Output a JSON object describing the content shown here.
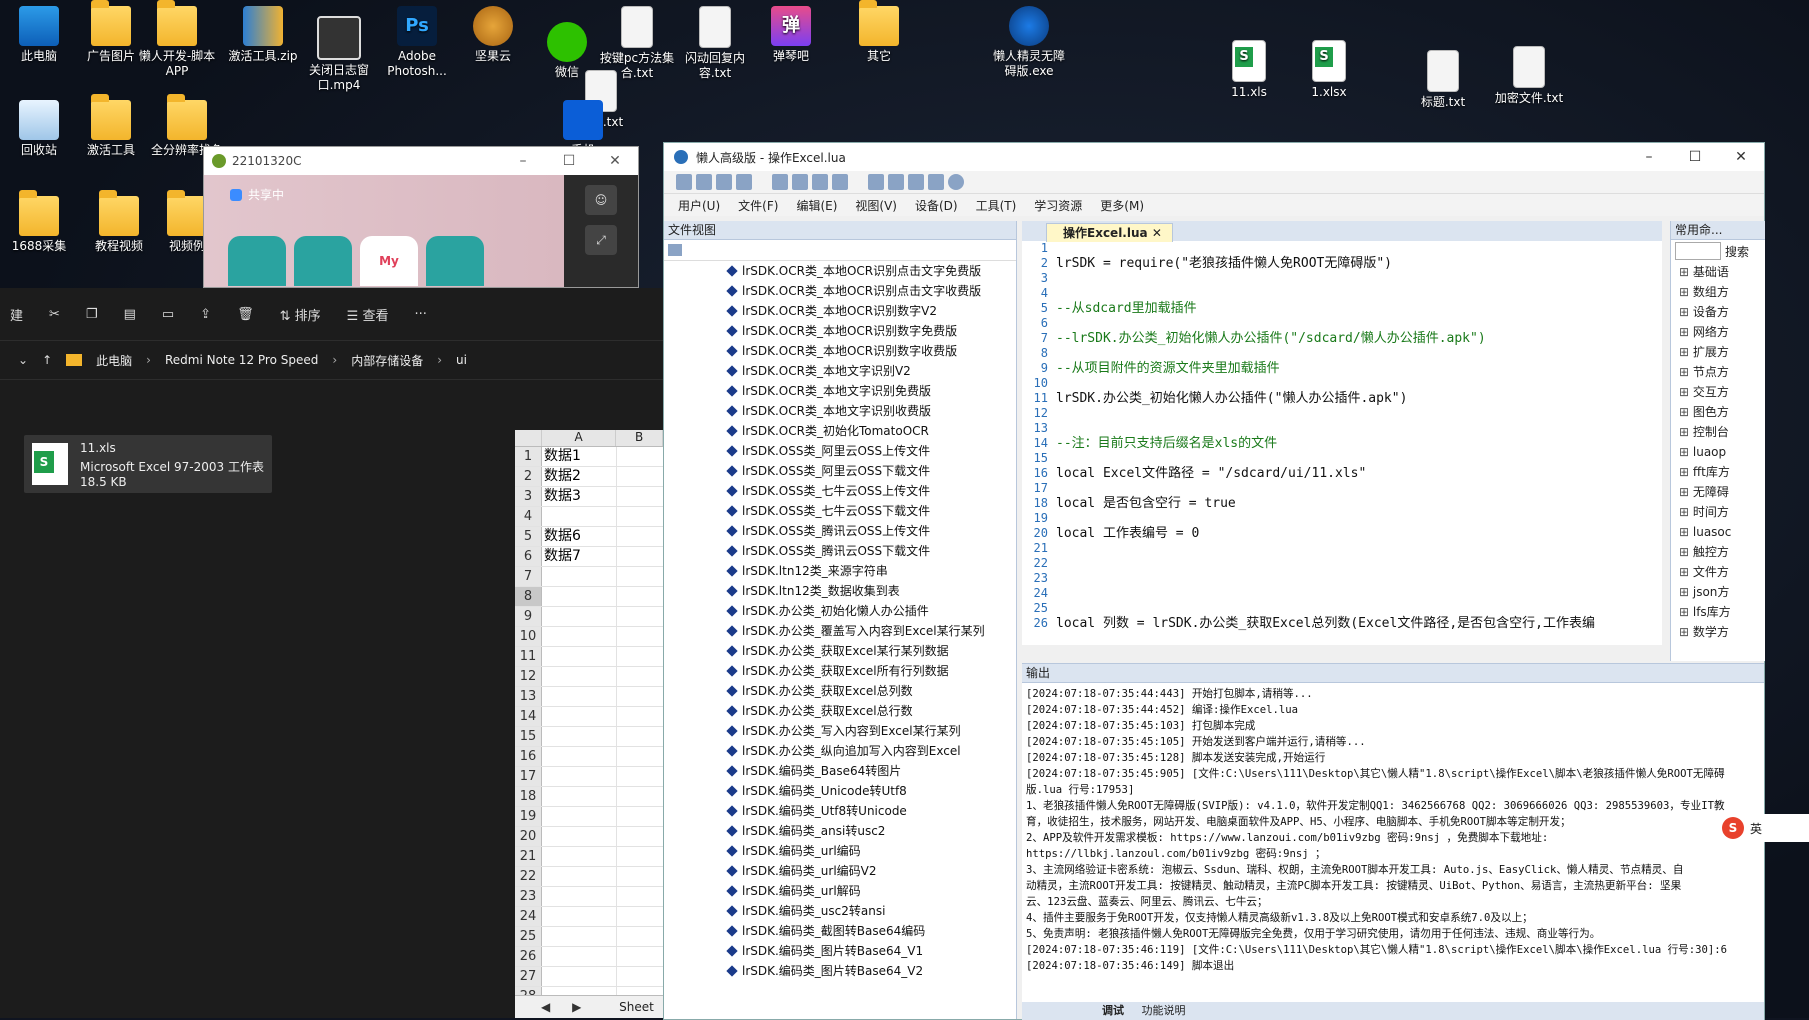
{
  "desktop": {
    "icons": [
      {
        "label": "此电脑",
        "type": "pc"
      },
      {
        "label": "广告图片",
        "type": "folder"
      },
      {
        "label": "懒人开发-脚本APP",
        "type": "folder"
      },
      {
        "label": "激活工具.zip",
        "type": "zip"
      },
      {
        "label": "关闭日志窗口.mp4",
        "type": "video"
      },
      {
        "label": "Adobe Photosh...",
        "type": "ps"
      },
      {
        "label": "坚果云",
        "type": "nut"
      },
      {
        "label": "微信",
        "type": "wechat"
      },
      {
        "label": "按键pc方法集合.txt",
        "type": "doc"
      },
      {
        "label": "闪动回复内容.txt",
        "type": "doc"
      },
      {
        "label": "弹琴吧",
        "type": "tan"
      },
      {
        "label": "其它",
        "type": "folder"
      },
      {
        "label": "懒人精灵无障碍版.exe",
        "type": "gear"
      },
      {
        "label": "11.xls",
        "type": "xls"
      },
      {
        "label": "1.xlsx",
        "type": "xls"
      },
      {
        "label": "标题.txt",
        "type": "doc"
      },
      {
        "label": "加密文件.txt",
        "type": "doc"
      },
      {
        "label": "回收站",
        "type": "recycle"
      },
      {
        "label": "激活工具",
        "type": "folder"
      },
      {
        "label": "全分辨率找色",
        "type": "folder"
      },
      {
        "label": "价格.txt",
        "type": "doc"
      },
      {
        "label": "手机",
        "type": "mobile"
      },
      {
        "label": "1688采集",
        "type": "folder"
      },
      {
        "label": "教程视频",
        "type": "folder"
      },
      {
        "label": "视频例",
        "type": "folder"
      }
    ]
  },
  "phone": {
    "title": "22101320C",
    "sharing": "共享中",
    "app_label": "My"
  },
  "explorer": {
    "toolbar": {
      "new": "建",
      "sort": "排序",
      "view": "查看",
      "more": "···"
    },
    "breadcrumb": [
      "此电脑",
      "Redmi Note 12 Pro Speed",
      "内部存储设备",
      "ui"
    ],
    "file": {
      "name": "11.xls",
      "type": "Microsoft Excel 97-2003 工作表",
      "size": "18.5 KB"
    }
  },
  "sheet": {
    "cols": [
      "A",
      "B"
    ],
    "rows": [
      {
        "n": "1",
        "a": "数据1"
      },
      {
        "n": "2",
        "a": "数据2"
      },
      {
        "n": "3",
        "a": "数据3"
      },
      {
        "n": "4",
        "a": ""
      },
      {
        "n": "5",
        "a": "数据6"
      },
      {
        "n": "6",
        "a": "数据7"
      },
      {
        "n": "7",
        "a": ""
      },
      {
        "n": "8",
        "a": ""
      },
      {
        "n": "9",
        "a": ""
      },
      {
        "n": "10",
        "a": ""
      },
      {
        "n": "11",
        "a": ""
      },
      {
        "n": "12",
        "a": ""
      },
      {
        "n": "13",
        "a": ""
      },
      {
        "n": "14",
        "a": ""
      },
      {
        "n": "15",
        "a": ""
      },
      {
        "n": "16",
        "a": ""
      },
      {
        "n": "17",
        "a": ""
      },
      {
        "n": "18",
        "a": ""
      },
      {
        "n": "19",
        "a": ""
      },
      {
        "n": "20",
        "a": ""
      },
      {
        "n": "21",
        "a": ""
      },
      {
        "n": "22",
        "a": ""
      },
      {
        "n": "23",
        "a": ""
      },
      {
        "n": "24",
        "a": ""
      },
      {
        "n": "25",
        "a": ""
      },
      {
        "n": "26",
        "a": ""
      },
      {
        "n": "27",
        "a": ""
      },
      {
        "n": "28",
        "a": ""
      }
    ],
    "selected_row": "8",
    "tab": "Sheet"
  },
  "ide": {
    "title": "懒人高级版 - 操作Excel.lua",
    "menu": [
      "用户(U)",
      "文件(F)",
      "编辑(E)",
      "视图(V)",
      "设备(D)",
      "工具(T)",
      "学习资源",
      "更多(M)"
    ],
    "fileview_title": "文件视图",
    "fileview_items": [
      "lrSDK.OCR类_本地OCR识别点击文字免费版",
      "lrSDK.OCR类_本地OCR识别点击文字收费版",
      "lrSDK.OCR类_本地OCR识别数字V2",
      "lrSDK.OCR类_本地OCR识别数字免费版",
      "lrSDK.OCR类_本地OCR识别数字收费版",
      "lrSDK.OCR类_本地文字识别V2",
      "lrSDK.OCR类_本地文字识别免费版",
      "lrSDK.OCR类_本地文字识别收费版",
      "lrSDK.OCR类_初始化TomatoOCR",
      "lrSDK.OSS类_阿里云OSS上传文件",
      "lrSDK.OSS类_阿里云OSS下载文件",
      "lrSDK.OSS类_七牛云OSS上传文件",
      "lrSDK.OSS类_七牛云OSS下载文件",
      "lrSDK.OSS类_腾讯云OSS上传文件",
      "lrSDK.OSS类_腾讯云OSS下载文件",
      "lrSDK.ltn12类_来源字符串",
      "lrSDK.ltn12类_数据收集到表",
      "lrSDK.办公类_初始化懒人办公插件",
      "lrSDK.办公类_覆盖写入内容到Excel某行某列",
      "lrSDK.办公类_获取Excel某行某列数据",
      "lrSDK.办公类_获取Excel所有行列数据",
      "lrSDK.办公类_获取Excel总列数",
      "lrSDK.办公类_获取Excel总行数",
      "lrSDK.办公类_写入内容到Excel某行某列",
      "lrSDK.办公类_纵向追加写入内容到Excel",
      "lrSDK.编码类_Base64转图片",
      "lrSDK.编码类_Unicode转Utf8",
      "lrSDK.编码类_Utf8转Unicode",
      "lrSDK.编码类_ansi转usc2",
      "lrSDK.编码类_url编码",
      "lrSDK.编码类_url编码V2",
      "lrSDK.编码类_url解码",
      "lrSDK.编码类_usc2转ansi",
      "lrSDK.编码类_截图转Base64编码",
      "lrSDK.编码类_图片转Base64_V1",
      "lrSDK.编码类_图片转Base64_V2"
    ],
    "editor_tab": "操作Excel.lua",
    "code": [
      {
        "n": "1",
        "t": "",
        "c": false
      },
      {
        "n": "2",
        "t": "lrSDK = require(\"老狼孩插件懒人免ROOT无障碍版\")",
        "c": false
      },
      {
        "n": "3",
        "t": "",
        "c": false
      },
      {
        "n": "4",
        "t": "",
        "c": false
      },
      {
        "n": "5",
        "t": "--从sdcard里加载插件",
        "c": true
      },
      {
        "n": "6",
        "t": "",
        "c": false
      },
      {
        "n": "7",
        "t": "--lrSDK.办公类_初始化懒人办公插件(\"/sdcard/懒人办公插件.apk\")",
        "c": true
      },
      {
        "n": "8",
        "t": "",
        "c": false
      },
      {
        "n": "9",
        "t": "--从项目附件的资源文件夹里加载插件",
        "c": true
      },
      {
        "n": "10",
        "t": "",
        "c": false
      },
      {
        "n": "11",
        "t": "lrSDK.办公类_初始化懒人办公插件(\"懒人办公插件.apk\")",
        "c": false
      },
      {
        "n": "12",
        "t": "",
        "c": false
      },
      {
        "n": "13",
        "t": "",
        "c": false
      },
      {
        "n": "14",
        "t": "--注：目前只支持后缀名是xls的文件",
        "c": true
      },
      {
        "n": "15",
        "t": "",
        "c": false
      },
      {
        "n": "16",
        "t": "local Excel文件路径 = \"/sdcard/ui/11.xls\"",
        "c": false
      },
      {
        "n": "17",
        "t": "",
        "c": false
      },
      {
        "n": "18",
        "t": "local 是否包含空行 = true",
        "c": false
      },
      {
        "n": "19",
        "t": "",
        "c": false
      },
      {
        "n": "20",
        "t": "local 工作表编号 = 0",
        "c": false
      },
      {
        "n": "21",
        "t": "",
        "c": false
      },
      {
        "n": "22",
        "t": "",
        "c": false
      },
      {
        "n": "23",
        "t": "",
        "c": false
      },
      {
        "n": "24",
        "t": "",
        "c": false
      },
      {
        "n": "25",
        "t": "",
        "c": false
      },
      {
        "n": "26",
        "t": "local 列数 = lrSDK.办公类_获取Excel总列数(Excel文件路径,是否包含空行,工作表编",
        "c": false
      }
    ],
    "cmd_title": "常用命...",
    "cmd_search": "搜索",
    "cmd_items": [
      "基础语",
      "数组方",
      "设备方",
      "网络方",
      "扩展方",
      "节点方",
      "交互方",
      "图色方",
      "控制台",
      "luaop",
      "fft库方",
      "无障碍",
      "时间方",
      "luasoc",
      "触控方",
      "文件方",
      "json方",
      "lfs库方",
      "数学方"
    ],
    "output_title": "输出",
    "output": [
      "[2024:07:18-07:35:44:443] 开始打包脚本,请稍等...",
      "[2024:07:18-07:35:44:452] 编译:操作Excel.lua",
      "[2024:07:18-07:35:45:103] 打包脚本完成",
      "[2024:07:18-07:35:45:105] 开始发送到客户端并运行,请稍等...",
      "[2024:07:18-07:35:45:128] 脚本发送安装完成,开始运行",
      "[2024:07:18-07:35:45:905] [文件:C:\\Users\\111\\Desktop\\其它\\懒人精\"1.8\\script\\操作Excel\\脚本\\老狼孩插件懒人免ROOT无障碍",
      "版.lua 行号:17953]",
      "1、老狼孩插件懒人免ROOT无障碍版(SVIP版): v4.1.0，软件开发定制QQ1: 3462566768 QQ2: 3069666026 QQ3: 2985539603，专业IT教",
      "育，收徒招生，技术服务，网站开发、电脑桌面软件及APP、H5、小程序、电脑脚本、手机免ROOT脚本等定制开发；",
      "2、APP及软件开发需求模板: https://www.lanzoui.com/b01iv9zbg 密码:9nsj ，免费脚本下载地址:",
      "https://llbkj.lanzoul.com/b01iv9zbg 密码:9nsj ；",
      "3、主流网络验证卡密系统: 泡椒云、Ssdun、瑞科、权朗，主流免ROOT脚本开发工具: Auto.js、EasyClick、懒人精灵、节点精灵、自",
      "动精灵，主流ROOT开发工具: 按键精灵、触动精灵，主流PC脚本开发工具: 按键精灵、UiBot、Python、易语言，主流热更新平台: 坚果",
      "云、123云盘、蓝奏云、阿里云、腾讯云、七牛云；",
      "4、插件主要服务于免ROOT开发，仅支持懒人精灵高级新v1.3.8及以上免ROOT模式和安卓系统7.0及以上；",
      "5、免责声明: 老狼孩插件懒人免ROOT无障碍版完全免费，仅用于学习研究使用，请勿用于任何违法、违规、商业等行为。",
      "[2024:07:18-07:35:46:119] [文件:C:\\Users\\111\\Desktop\\其它\\懒人精\"1.8\\script\\操作Excel\\脚本\\操作Excel.lua 行号:30]:6",
      "[2024:07:18-07:35:46:149] 脚本退出"
    ],
    "output_tabs": [
      "调试",
      "功能说明"
    ]
  },
  "ime": {
    "label": "英"
  }
}
